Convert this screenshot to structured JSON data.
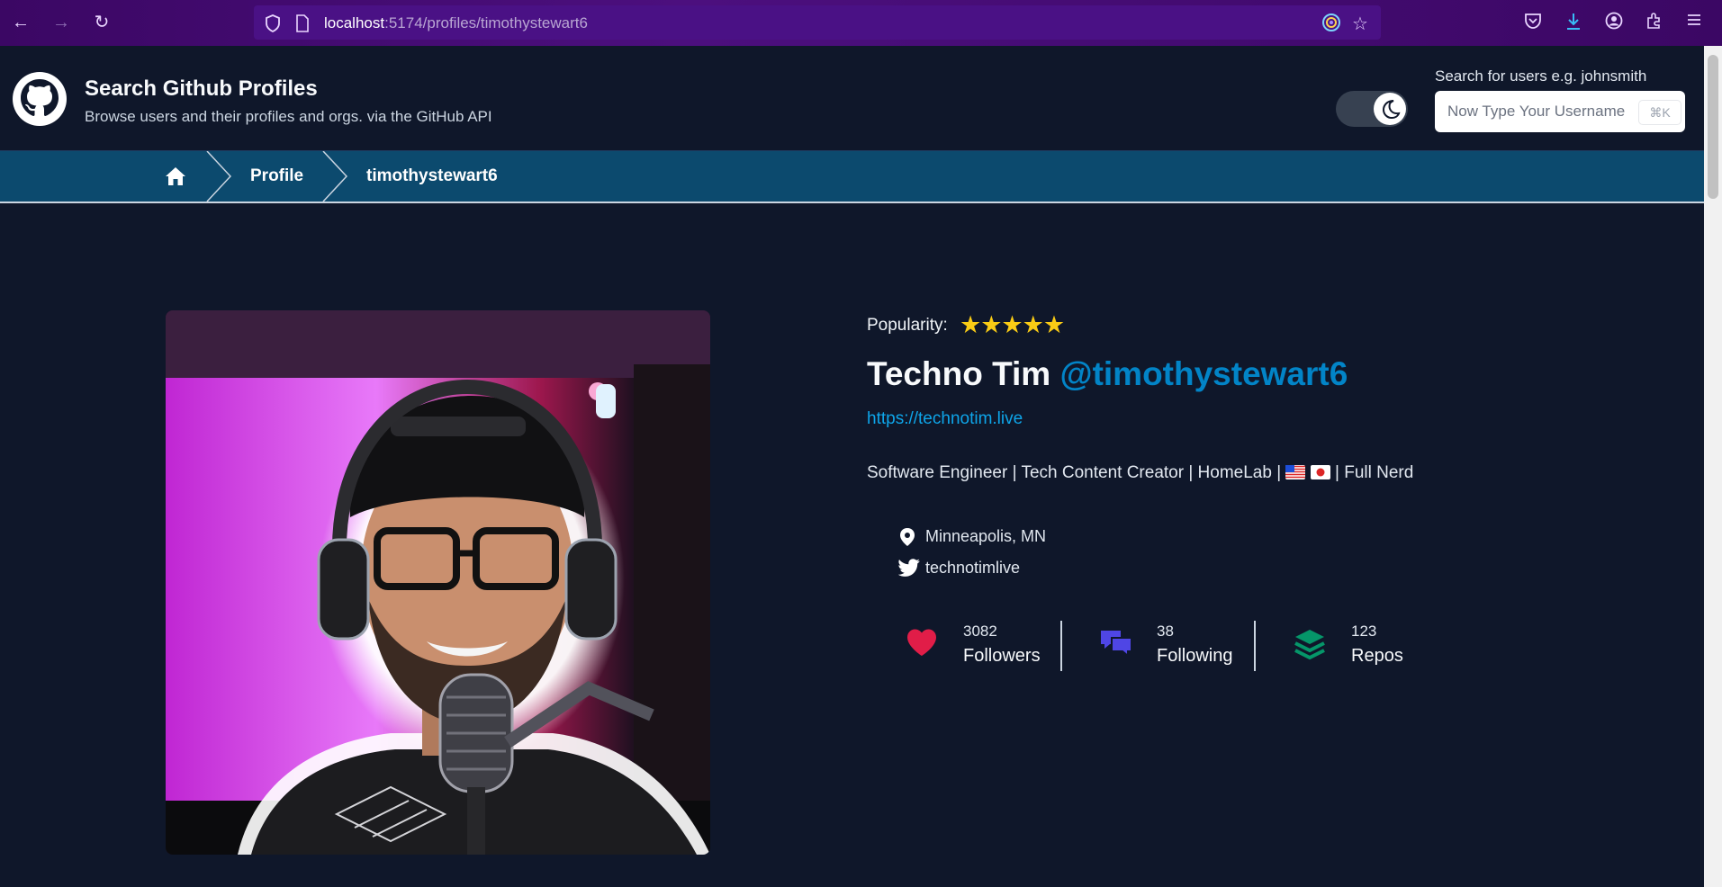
{
  "browser": {
    "url_host": "localhost",
    "url_path": ":5174/profiles/timothystewart6"
  },
  "app": {
    "title": "Search Github Profiles",
    "subtitle": "Browse users and their profiles and orgs. via the GitHub API"
  },
  "search": {
    "label": "Search for users e.g. johnsmith",
    "placeholder": "Now Type Your Username",
    "shortcut": "⌘K"
  },
  "breadcrumb": {
    "profile": "Profile",
    "user": "timothystewart6"
  },
  "profile": {
    "popularity_label": "Popularity:",
    "stars": "★★★★★",
    "star_rating": 5,
    "name": "Techno Tim",
    "login": "@timothystewart6",
    "blog": "https://technotim.live",
    "bio_prefix": "Software Engineer | Tech Content Creator | HomeLab |",
    "bio_suffix": "| Full Nerd",
    "location": "Minneapolis, MN",
    "twitter": "technotimlive"
  },
  "stats": {
    "followers_count": "3082",
    "followers_label": "Followers",
    "following_count": "38",
    "following_label": "Following",
    "repos_count": "123",
    "repos_label": "Repos"
  },
  "colors": {
    "background": "#0f172a",
    "breadcrumb": "#0c4a6e",
    "accent": "#0284c7",
    "star": "#facc15",
    "heart": "#e11d48",
    "chat": "#4f46e5",
    "layers": "#059669"
  }
}
